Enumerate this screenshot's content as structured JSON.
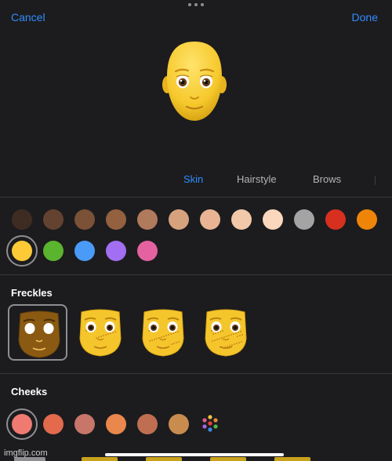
{
  "nav": {
    "cancel_label": "Cancel",
    "done_label": "Done"
  },
  "tabs": [
    {
      "label": "Skin",
      "active": true
    },
    {
      "label": "Hairstyle",
      "active": false
    },
    {
      "label": "Brows",
      "active": false
    }
  ],
  "skin_colors": [
    "#3e2c23",
    "#644230",
    "#7b5137",
    "#946140",
    "#b07a5c",
    "#d6a27d",
    "#e8b494",
    "#f1c8aa",
    "#fad7bd",
    "#a4a4a4",
    "#d7301f",
    "#ee8508",
    "#fcc937",
    "#5ab42d",
    "#4a9bf7",
    "#a26ef2",
    "#e3629f"
  ],
  "skin_selected": "#fcc937",
  "freckles": {
    "title": "Freckles",
    "options": [
      "none",
      "light",
      "medium",
      "heavy"
    ],
    "selected": "none"
  },
  "cheeks": {
    "title": "Cheeks",
    "colors": [
      "#ef7a72",
      "#e36a4c",
      "#c77669",
      "#e9874c",
      "#c06e52",
      "#c98c4f"
    ],
    "selected": "#ef7a72"
  },
  "watermark": "imgflip.com",
  "icons": {
    "grabber": "grabber-icon",
    "multicolor": "multicolor-picker-icon"
  }
}
